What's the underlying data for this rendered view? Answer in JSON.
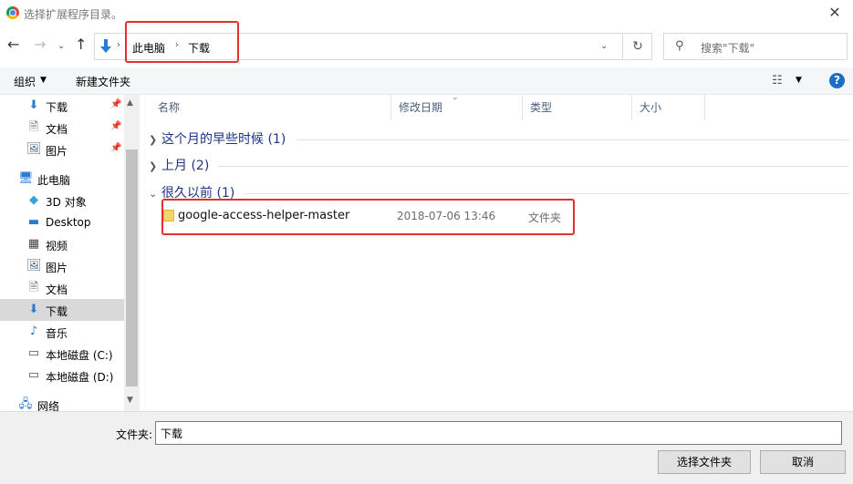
{
  "window": {
    "title": "选择扩展程序目录。",
    "close_glyph": "✕"
  },
  "address": {
    "crumbs": [
      "此电脑",
      "下载"
    ],
    "search_placeholder": "搜索\"下载\""
  },
  "commands": {
    "organize": "组织",
    "new_folder": "新建文件夹"
  },
  "nav": {
    "items": [
      {
        "label": "下载",
        "icon": "download-icon",
        "pinned": true
      },
      {
        "label": "文档",
        "icon": "document-icon",
        "pinned": true
      },
      {
        "label": "图片",
        "icon": "picture-icon",
        "pinned": true
      },
      {
        "label": "此电脑",
        "icon": "computer-icon",
        "pinned": false
      },
      {
        "label": "3D 对象",
        "icon": "cube-icon",
        "pinned": false
      },
      {
        "label": "Desktop",
        "icon": "desktop-icon",
        "pinned": false
      },
      {
        "label": "视频",
        "icon": "video-icon",
        "pinned": false
      },
      {
        "label": "图片",
        "icon": "picture-icon",
        "pinned": false
      },
      {
        "label": "文档",
        "icon": "document-icon",
        "pinned": false
      },
      {
        "label": "下载",
        "icon": "download-icon",
        "pinned": false,
        "selected": true
      },
      {
        "label": "音乐",
        "icon": "music-icon",
        "pinned": false
      },
      {
        "label": "本地磁盘 (C:)",
        "icon": "drive-icon",
        "pinned": false
      },
      {
        "label": "本地磁盘 (D:)",
        "icon": "drive-icon",
        "pinned": false
      },
      {
        "label": "网络",
        "icon": "network-icon",
        "pinned": false
      }
    ]
  },
  "columns": {
    "name": "名称",
    "modified": "修改日期",
    "type": "类型",
    "size": "大小"
  },
  "groups": [
    {
      "label": "这个月的早些时候 (1)",
      "expanded": false
    },
    {
      "label": "上月 (2)",
      "expanded": false
    },
    {
      "label": "很久以前 (1)",
      "expanded": true
    }
  ],
  "files": [
    {
      "name": "google-access-helper-master",
      "modified": "2018-07-06 13:46",
      "type": "文件夹"
    }
  ],
  "footer": {
    "folder_label": "文件夹:",
    "folder_value": "下载",
    "select_button": "选择文件夹",
    "cancel_button": "取消"
  },
  "colors": {
    "highlight": "#e03030",
    "group_text": "#1e3287",
    "selected_nav": "#d9d9d9"
  }
}
